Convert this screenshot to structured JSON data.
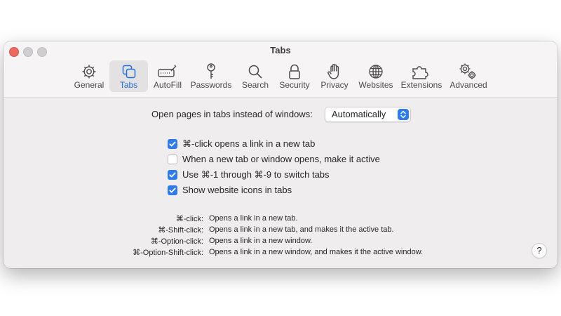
{
  "window": {
    "title": "Tabs",
    "traffic_lights": [
      "close",
      "minimize",
      "zoom"
    ]
  },
  "toolbar": {
    "selected": "Tabs",
    "items": [
      {
        "label": "General",
        "icon": "gear-icon"
      },
      {
        "label": "Tabs",
        "icon": "tabs-icon"
      },
      {
        "label": "AutoFill",
        "icon": "autofill-pen-icon"
      },
      {
        "label": "Passwords",
        "icon": "key-icon"
      },
      {
        "label": "Search",
        "icon": "magnifier-icon"
      },
      {
        "label": "Security",
        "icon": "lock-icon"
      },
      {
        "label": "Privacy",
        "icon": "hand-icon"
      },
      {
        "label": "Websites",
        "icon": "globe-icon"
      },
      {
        "label": "Extensions",
        "icon": "puzzle-icon"
      },
      {
        "label": "Advanced",
        "icon": "gears-icon"
      }
    ]
  },
  "tabs_pane": {
    "open_pages_label": "Open pages in tabs instead of windows:",
    "open_pages_value": "Automatically",
    "checkboxes": [
      {
        "label": "⌘-click opens a link in a new tab",
        "checked": true
      },
      {
        "label": "When a new tab or window opens, make it active",
        "checked": false
      },
      {
        "label": "Use ⌘-1 through ⌘-9 to switch tabs",
        "checked": true
      },
      {
        "label": "Show website icons in tabs",
        "checked": true
      }
    ],
    "legend": [
      {
        "key": "⌘-click:",
        "desc": "Opens a link in a new tab."
      },
      {
        "key": "⌘-Shift-click:",
        "desc": "Opens a link in a new tab, and makes it the active tab."
      },
      {
        "key": "⌘-Option-click:",
        "desc": "Opens a link in a new window."
      },
      {
        "key": "⌘-Option-Shift-click:",
        "desc": "Opens a link in a new window, and makes it the active window."
      }
    ],
    "help_label": "?"
  },
  "colors": {
    "accent": "#2f7be8",
    "close": "#ec6a5e",
    "window_bg": "#efedee",
    "toolbar_bg": "#f6f4f5"
  }
}
